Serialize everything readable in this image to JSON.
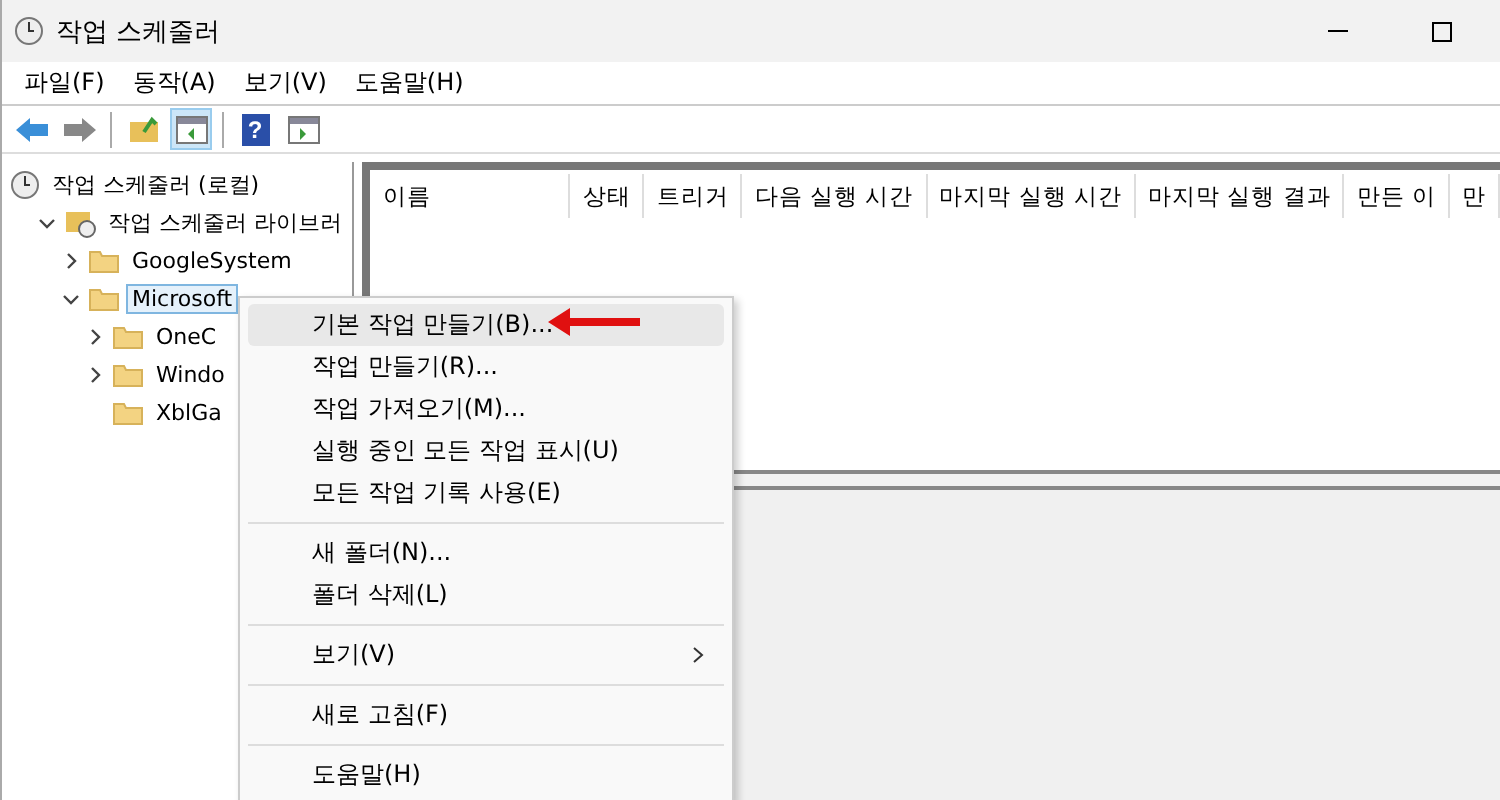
{
  "window": {
    "title": "작업 스케줄러"
  },
  "menu_bar": [
    "파일(F)",
    "동작(A)",
    "보기(V)",
    "도움말(H)"
  ],
  "toolbar": [
    {
      "kind": "back",
      "pressed": false
    },
    {
      "kind": "forward",
      "pressed": false
    },
    {
      "kind": "separator"
    },
    {
      "kind": "up",
      "pressed": false
    },
    {
      "kind": "tree",
      "pressed": true
    },
    {
      "kind": "separator"
    },
    {
      "kind": "help",
      "label": "?",
      "pressed": false
    },
    {
      "kind": "pane",
      "pressed": false
    }
  ],
  "tree": {
    "items": [
      {
        "label": "작업 스케줄러 (로컬)",
        "selected": false,
        "children": [
          {
            "label": "작업 스케줄러 라이브러",
            "expanded": true,
            "selected": false,
            "children": [
              {
                "label": "GoogleSystem",
                "expanded": false,
                "selected": false
              },
              {
                "label": "Microsoft",
                "expanded": true,
                "selected": true,
                "children": [
                  {
                    "label": "OneC",
                    "expanded": false,
                    "selected": false
                  },
                  {
                    "label": "Windo",
                    "expanded": false,
                    "selected": false
                  },
                  {
                    "label": "XblGa",
                    "selected": false
                  }
                ]
              }
            ]
          }
        ]
      }
    ]
  },
  "table": {
    "columns": [
      "이름",
      "상태",
      "트리거",
      "다음 실행 시간",
      "마지막 실행 시간",
      "마지막 실행 결과",
      "만든 이",
      "만"
    ]
  },
  "context_menu": {
    "items": [
      {
        "kind": "item",
        "label": "기본 작업 만들기(B)...",
        "selected": true,
        "submenu": false
      },
      {
        "kind": "item",
        "label": "작업 만들기(R)...",
        "selected": false,
        "submenu": false
      },
      {
        "kind": "item",
        "label": "작업 가져오기(M)...",
        "selected": false,
        "submenu": false
      },
      {
        "kind": "item",
        "label": "실행 중인 모든 작업 표시(U)",
        "selected": false,
        "submenu": false
      },
      {
        "kind": "item",
        "label": "모든 작업 기록 사용(E)",
        "selected": false,
        "submenu": false
      },
      {
        "kind": "separator"
      },
      {
        "kind": "item",
        "label": "새 폴더(N)...",
        "selected": false,
        "submenu": false
      },
      {
        "kind": "item",
        "label": "폴더 삭제(L)",
        "selected": false,
        "submenu": false
      },
      {
        "kind": "separator"
      },
      {
        "kind": "item",
        "label": "보기(V)",
        "selected": false,
        "submenu": true
      },
      {
        "kind": "separator"
      },
      {
        "kind": "item",
        "label": "새로 고침(F)",
        "selected": false,
        "submenu": false
      },
      {
        "kind": "separator"
      },
      {
        "kind": "item",
        "label": "도움말(H)",
        "selected": false,
        "submenu": false
      }
    ]
  }
}
